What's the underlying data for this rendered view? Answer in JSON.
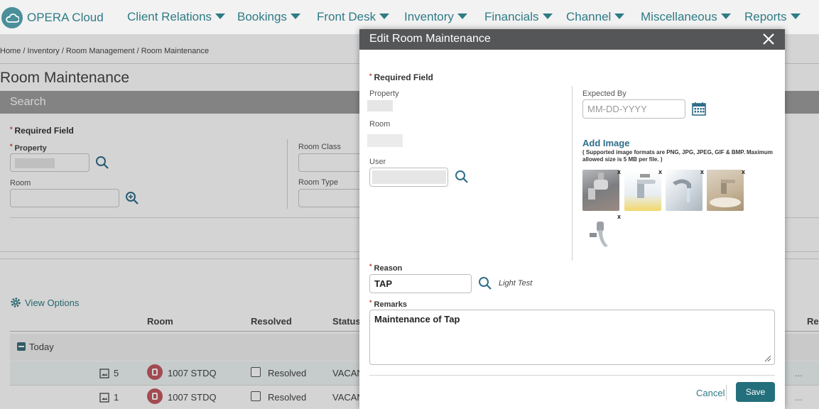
{
  "nav": {
    "logo_text": "OPERA Cloud",
    "items": [
      "Client Relations",
      "Bookings",
      "Front Desk",
      "Inventory",
      "Financials",
      "Channel",
      "Miscellaneous",
      "Reports"
    ]
  },
  "page": {
    "breadcrumb": "Home / Inventory / Room Management / Room Maintenance",
    "title": "Room Maintenance",
    "search_bar": "Search",
    "required_field": "Required Field",
    "fields": {
      "property": "Property",
      "room": "Room",
      "room_class": "Room Class",
      "room_type": "Room Type"
    },
    "view_options": "View Options",
    "table": {
      "headers": [
        "Room",
        "Resolved",
        "Status",
        "Res"
      ],
      "group": "Today",
      "rows": [
        {
          "count": "5",
          "room": "1007 STDQ",
          "resolved": "Resolved",
          "status": "VACAN"
        },
        {
          "count": "1",
          "room": "1007 STDQ",
          "resolved": "Resolved",
          "status": "VACAN"
        }
      ],
      "ellipsis": "..."
    }
  },
  "modal": {
    "title": "Edit Room Maintenance",
    "required_field": "Required Field",
    "property_label": "Property",
    "room_label": "Room",
    "user_label": "User",
    "expected_by_label": "Expected By",
    "expected_by_placeholder": "MM-DD-YYYY",
    "add_image": "Add Image",
    "image_note": "( Supported image formats are PNG, JPG, JPEG, GIF & BMP. Maximum allowed size is 5 MB per file. )",
    "image_remove": "x",
    "reason_label": "Reason",
    "reason_value": "TAP",
    "reason_desc": "Light Test",
    "remarks_label": "Remarks",
    "remarks_value": "Maintenance of Tap",
    "cancel": "Cancel",
    "save": "Save"
  },
  "colors": {
    "accent": "#2f7b86",
    "header_bar": "#555657",
    "save_button": "#246f7c",
    "required_star": "#c0392b"
  }
}
